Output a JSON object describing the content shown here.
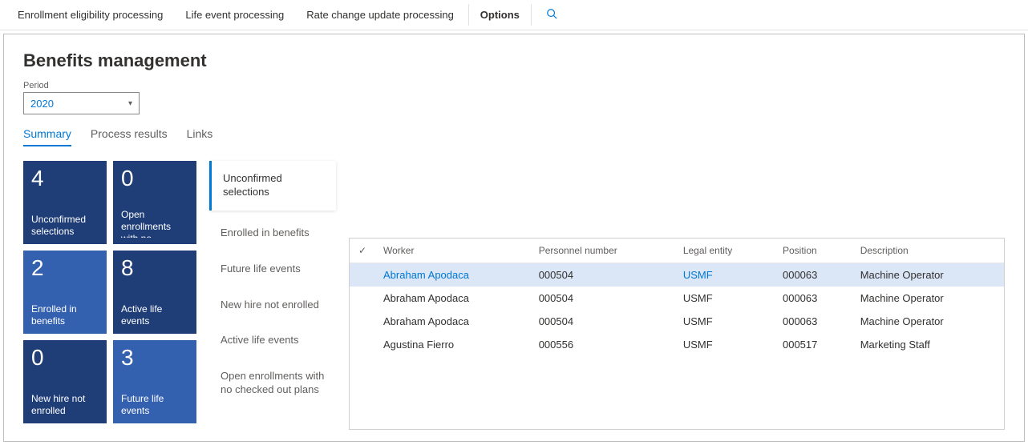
{
  "topbar": {
    "items": [
      "Enrollment eligibility processing",
      "Life event processing",
      "Rate change update processing",
      "Options"
    ],
    "activeIndex": 3
  },
  "page": {
    "title": "Benefits management",
    "periodLabel": "Period",
    "periodValue": "2020"
  },
  "tabs": {
    "items": [
      "Summary",
      "Process results",
      "Links"
    ],
    "activeIndex": 0
  },
  "tiles": [
    {
      "count": "4",
      "label": "Unconfirmed selections",
      "shade": "dark"
    },
    {
      "count": "0",
      "label": "Open enrollments with no...",
      "shade": "dark"
    },
    {
      "count": "2",
      "label": "Enrolled in benefits",
      "shade": "med"
    },
    {
      "count": "8",
      "label": "Active life events",
      "shade": "dark"
    },
    {
      "count": "0",
      "label": "New hire not enrolled",
      "shade": "dark"
    },
    {
      "count": "3",
      "label": "Future life events",
      "shade": "med"
    }
  ],
  "categories": {
    "items": [
      "Unconfirmed selections",
      "Enrolled in benefits",
      "Future life events",
      "New hire not enrolled",
      "Active life events",
      "Open enrollments with no checked out plans"
    ],
    "selectedIndex": 0
  },
  "table": {
    "columns": [
      "Worker",
      "Personnel number",
      "Legal entity",
      "Position",
      "Description"
    ],
    "rows": [
      {
        "worker": "Abraham Apodaca",
        "personnel": "000504",
        "entity": "USMF",
        "position": "000063",
        "description": "Machine Operator",
        "selected": true
      },
      {
        "worker": "Abraham Apodaca",
        "personnel": "000504",
        "entity": "USMF",
        "position": "000063",
        "description": "Machine Operator",
        "selected": false
      },
      {
        "worker": "Abraham Apodaca",
        "personnel": "000504",
        "entity": "USMF",
        "position": "000063",
        "description": "Machine Operator",
        "selected": false
      },
      {
        "worker": "Agustina Fierro",
        "personnel": "000556",
        "entity": "USMF",
        "position": "000517",
        "description": "Marketing Staff",
        "selected": false
      }
    ]
  }
}
